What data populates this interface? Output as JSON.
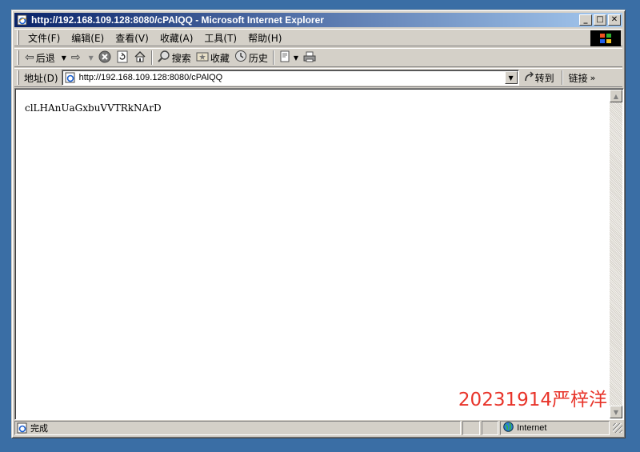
{
  "window": {
    "title": "http://192.168.109.128:8080/cPAlQQ - Microsoft Internet Explorer",
    "controls": {
      "minimize": "_",
      "maximize": "□",
      "close": "✕"
    }
  },
  "menu": [
    "文件(F)",
    "编辑(E)",
    "查看(V)",
    "收藏(A)",
    "工具(T)",
    "帮助(H)"
  ],
  "toolbar": {
    "back_label": "后退",
    "search_label": "搜索",
    "favorites_label": "收藏",
    "history_label": "历史"
  },
  "address": {
    "label": "地址(D)",
    "url": "http://192.168.109.128:8080/cPAlQQ",
    "go_label": "转到",
    "links_label": "链接"
  },
  "page": {
    "body_text": "clLHAnUaGxbuVVTRkNArD",
    "watermark": "20231914严梓洋"
  },
  "status": {
    "text": "完成",
    "zone": "Internet"
  },
  "colors": {
    "title_gradient_start": "#0a246a",
    "title_gradient_end": "#a6caf0",
    "chrome": "#d4d0c8",
    "desktop": "#3a6ea5",
    "watermark": "#e8342a"
  },
  "icons": [
    "ie-page-icon",
    "back-arrow-icon",
    "forward-arrow-icon",
    "stop-icon",
    "refresh-icon",
    "home-icon",
    "search-icon",
    "favorites-icon",
    "history-icon",
    "mail-icon",
    "print-icon",
    "go-arrow-icon",
    "windows-logo-icon",
    "globe-icon"
  ]
}
